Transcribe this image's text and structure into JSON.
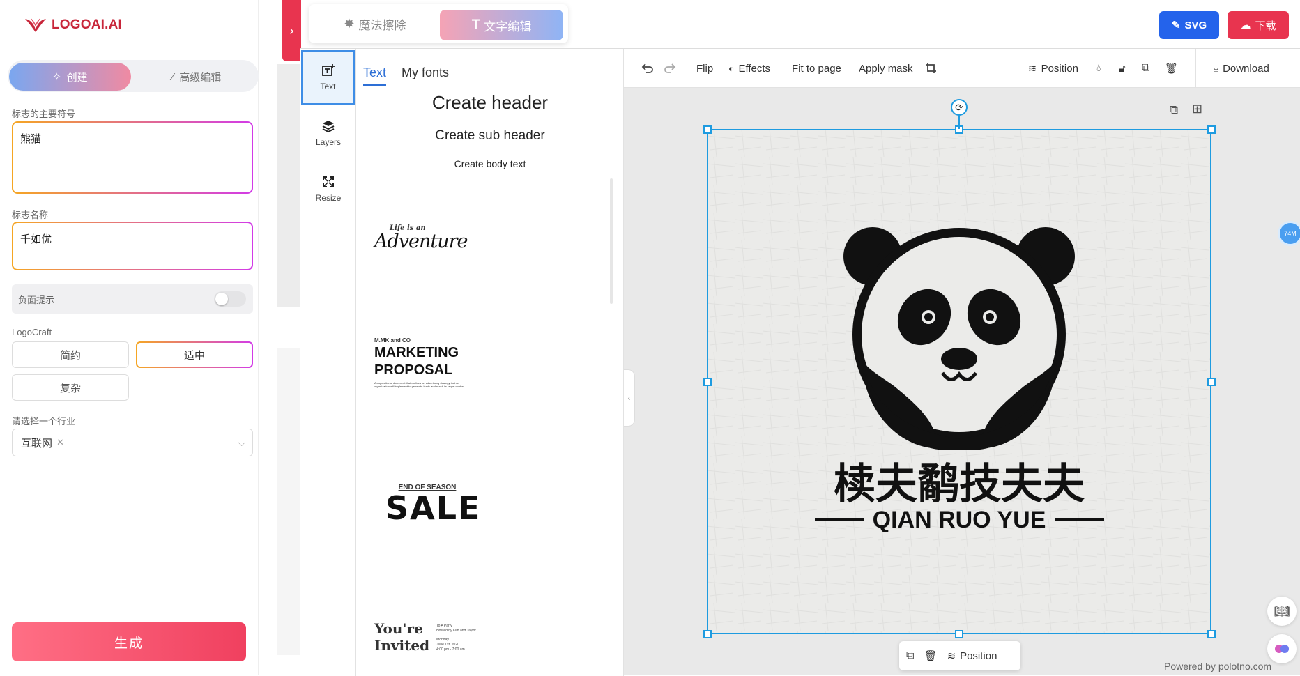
{
  "app": {
    "logo_text": "LOGOAI.AI"
  },
  "left": {
    "mode_create": "创建",
    "mode_advanced": "高级编辑",
    "symbol_label": "标志的主要符号",
    "symbol_value": "熊猫",
    "name_label": "标志名称",
    "name_value": "千如优",
    "negative_label": "负面提示",
    "craft_label": "LogoCraft",
    "craft_options": [
      "简约",
      "适中",
      "复杂"
    ],
    "craft_selected": "适中",
    "industry_label": "请选择一个行业",
    "industry_value": "互联网",
    "generate": "生成"
  },
  "topbar": {
    "magic_erase": "魔法擦除",
    "text_edit": "文字编辑",
    "svg_btn": "SVG",
    "download_btn": "下载"
  },
  "sidetabs": [
    "Text",
    "Layers",
    "Resize"
  ],
  "textpanel": {
    "tab_text": "Text",
    "tab_fonts": "My fonts",
    "create_header": "Create header",
    "create_sub": "Create sub header",
    "create_body": "Create body text",
    "templates": {
      "adventure_top": "Life is an",
      "adventure": "Adventure",
      "mk_top": "M.MK and CO",
      "marketing": "MARKETING",
      "proposal": "PROPOSAL",
      "mk_body": "An operational document that outlines an advertising strategy that an organization will implement to generate leads and reach its target market.",
      "sale_top": "END OF SEASON",
      "sale": "SALE",
      "invited_1": "You're",
      "invited_2": "Invited",
      "invited_side1": "To A Party",
      "invited_side2": "Hosted by Kim and Taylor",
      "invited_side3": "Monday",
      "invited_side4": "June 1st, 2020",
      "invited_side5": "4:00 pm - 7:00 am"
    }
  },
  "toolbar": {
    "flip": "Flip",
    "effects": "Effects",
    "fit": "Fit to page",
    "mask": "Apply mask",
    "position": "Position",
    "download": "Download"
  },
  "canvas": {
    "logo_cn": "椟夫鹬技夫夫",
    "logo_en": "QIAN RUO YUE"
  },
  "bottom": {
    "position": "Position"
  },
  "powered": "Powered by polotno.com",
  "badge": "74M",
  "colors": {
    "brand_red": "#e8344f",
    "svg_blue": "#2463eb",
    "select_blue": "#1e9be0"
  }
}
